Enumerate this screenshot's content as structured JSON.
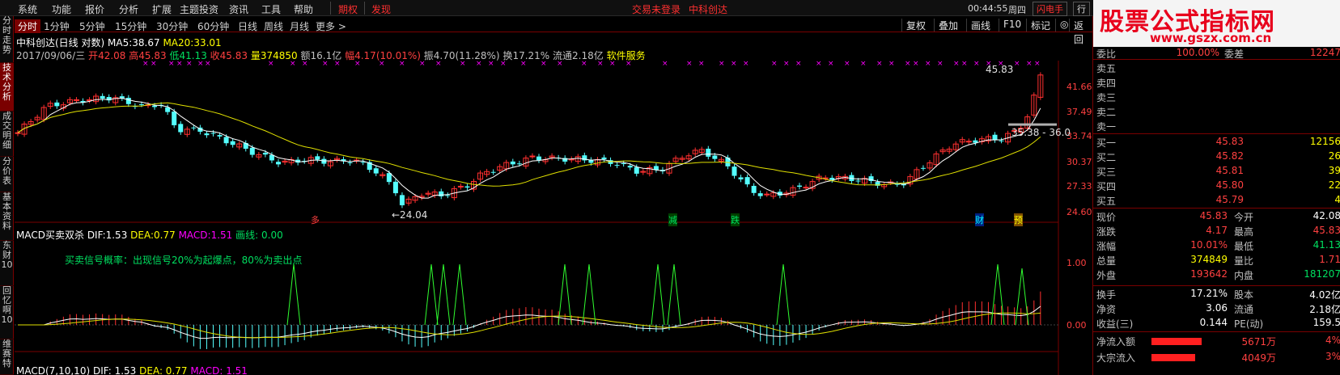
{
  "menu": {
    "items": [
      "系统",
      "功能",
      "报价",
      "分析",
      "扩展",
      "主题投资",
      "资讯",
      "工具",
      "帮助"
    ],
    "qiquan": "期权",
    "faxian": "发现",
    "login": "交易未登录",
    "stock_center": "中科创达",
    "time": "00:44:55",
    "weekday": "周四",
    "flash": "闪电手",
    "xing": "行"
  },
  "tabs": {
    "items": [
      "分时",
      "1分钟",
      "5分钟",
      "15分钟",
      "30分钟",
      "60分钟",
      "日线",
      "周线",
      "月线",
      "更多 >"
    ],
    "right": [
      "复权",
      "叠加",
      "画线",
      "F10",
      "标记",
      "◎",
      "返回"
    ]
  },
  "sidebar": {
    "items": [
      "分时走势",
      "技术分析",
      "成交明细",
      "分价表",
      "基本资料",
      "东财10",
      "回忆啊10",
      "维赛特"
    ]
  },
  "info": {
    "name": "中科创达(日线 对数)",
    "ma5_label": "MA5:",
    "ma5": "38.67",
    "ma20_label": "MA20:",
    "ma20": "33.01",
    "date": "2017/09/06/三",
    "open_l": "开",
    "open": "42.08",
    "high_l": "高",
    "high": "45.83",
    "low_l": "低",
    "low": "41.13",
    "close_l": "收",
    "close": "45.83",
    "vol_l": "量",
    "vol": "374850",
    "amt": "额16.1亿",
    "fu_l": "幅",
    "fu": "4.17(10.01%)",
    "zhen": "振4.70(11.28%)",
    "huan": "换17.21%",
    "liutong": "流通2.18亿",
    "sector": "软件服务"
  },
  "axis": {
    "main": [
      "41.66",
      "37.49",
      "33.74",
      "30.37",
      "27.33",
      "24.60"
    ],
    "macd": [
      "1.00",
      "0.00"
    ]
  },
  "chart_labels": {
    "peak": "45.83",
    "low": "←24.04",
    "range": "35.38 - 36.0",
    "sig1": "多",
    "sig2": "减",
    "sig3": "跌",
    "sig4": "财",
    "sig5": "预"
  },
  "macd": {
    "title": "MACD买卖双杀",
    "dif_l": "DIF:",
    "dif": "1.53",
    "dea_l": "DEA:",
    "dea": "0.77",
    "macd_l": "MACD:",
    "macd": "1.51",
    "huaxian": "画线: 0.00",
    "note": "买卖信号概率：出现信号20%为起爆点，80%为卖出点"
  },
  "macd2": {
    "title": "MACD(7,10,10)",
    "dif": "DIF: 1.53",
    "dea": "DEA: 0.77",
    "macd": "MACD: 1.51"
  },
  "logo": {
    "line1": "股票公式指标网",
    "line2": "www.gszx.com.cn"
  },
  "order": {
    "top_l": "委比",
    "top_v": "100.00%",
    "top_l2": "委差",
    "top_v2": "12247",
    "sells": [
      "卖五",
      "卖四",
      "卖三",
      "卖二",
      "卖一"
    ],
    "buys": [
      {
        "l": "买一",
        "p": "45.83",
        "v": "12156"
      },
      {
        "l": "买二",
        "p": "45.82",
        "v": "26"
      },
      {
        "l": "买三",
        "p": "45.81",
        "v": "39"
      },
      {
        "l": "买四",
        "p": "45.80",
        "v": "22"
      },
      {
        "l": "买五",
        "p": "45.79",
        "v": "4"
      }
    ]
  },
  "quote": [
    {
      "l": "现价",
      "v": "45.83",
      "l2": "今开",
      "v2": "42.08"
    },
    {
      "l": "涨跌",
      "v": "4.17",
      "l2": "最高",
      "v2": "45.83"
    },
    {
      "l": "涨幅",
      "v": "10.01%",
      "l2": "最低",
      "v2": "41.13"
    },
    {
      "l": "总量",
      "v": "374849",
      "l2": "量比",
      "v2": "1.71"
    },
    {
      "l": "外盘",
      "v": "193642",
      "l2": "内盘",
      "v2": "181207"
    }
  ],
  "finance": [
    {
      "l": "换手",
      "v": "17.21%",
      "l2": "股本",
      "v2": "4.02亿"
    },
    {
      "l": "净资",
      "v": "3.06",
      "l2": "流通",
      "v2": "2.18亿"
    },
    {
      "l": "收益(三)",
      "v": "0.144",
      "l2": "PE(动)",
      "v2": "159.5"
    }
  ],
  "flow": [
    {
      "l": "净流入额",
      "v": "5671万",
      "p": "4%"
    },
    {
      "l": "大宗流入",
      "v": "4049万",
      "p": "3%"
    }
  ]
}
